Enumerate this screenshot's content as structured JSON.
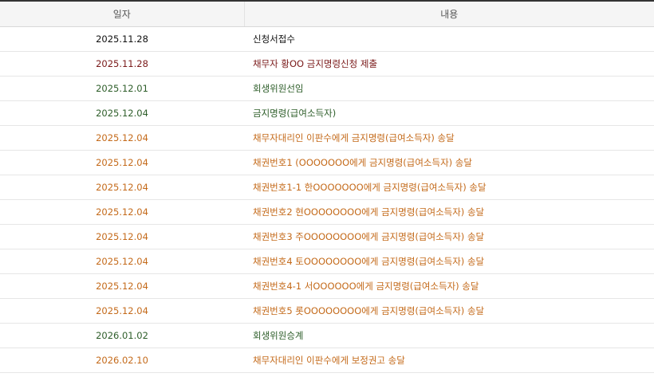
{
  "headers": {
    "date": "일자",
    "content": "내용"
  },
  "rows": [
    {
      "date": "2025.11.28",
      "content": "신청서접수",
      "color": "#111111"
    },
    {
      "date": "2025.11.28",
      "content": "채무자 황OO 금지명령신청 제출",
      "color": "#7a1a1a"
    },
    {
      "date": "2025.12.01",
      "content": "회생위원선임",
      "color": "#2e5e2a"
    },
    {
      "date": "2025.12.04",
      "content": "금지명령(급여소득자)",
      "color": "#2e5e2a"
    },
    {
      "date": "2025.12.04",
      "content": "채무자대리인 이판수에게 금지명령(급여소득자) 송달",
      "color": "#c46a1a"
    },
    {
      "date": "2025.12.04",
      "content": "채권번호1 (OOOOOOO에게 금지명령(급여소득자) 송달",
      "color": "#c46a1a"
    },
    {
      "date": "2025.12.04",
      "content": "채권번호1-1 한OOOOOOO에게 금지명령(급여소득자) 송달",
      "color": "#c46a1a"
    },
    {
      "date": "2025.12.04",
      "content": "채권번호2 현OOOOOOOO에게 금지명령(급여소득자) 송달",
      "color": "#c46a1a"
    },
    {
      "date": "2025.12.04",
      "content": "채권번호3 주OOOOOOOO에게 금지명령(급여소득자) 송달",
      "color": "#c46a1a"
    },
    {
      "date": "2025.12.04",
      "content": "채권번호4 토OOOOOOOO에게 금지명령(급여소득자) 송달",
      "color": "#c46a1a"
    },
    {
      "date": "2025.12.04",
      "content": "채권번호4-1 서OOOOOO에게 금지명령(급여소득자) 송달",
      "color": "#c46a1a"
    },
    {
      "date": "2025.12.04",
      "content": "채권번호5 롯OOOOOOOO에게 금지명령(급여소득자) 송달",
      "color": "#c46a1a"
    },
    {
      "date": "2026.01.02",
      "content": "회생위원승계",
      "color": "#2e5e2a"
    },
    {
      "date": "2026.02.10",
      "content": "채무자대리인 이판수에게 보정권고 송달",
      "color": "#c46a1a"
    }
  ]
}
